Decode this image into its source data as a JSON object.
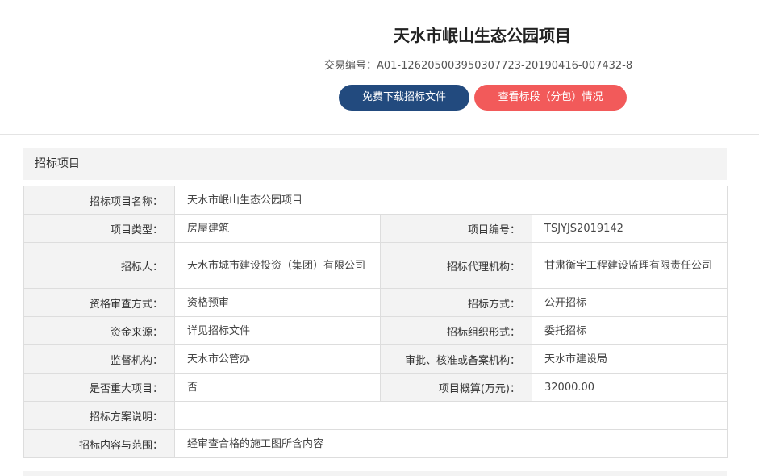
{
  "header": {
    "title": "天水市岷山生态公园项目",
    "transaction_code": "交易编号：A01-126205003950307723-20190416-007432-8",
    "download_button": "免费下载招标文件",
    "sections_button": "查看标段（分包）情况"
  },
  "section": {
    "title": "招标项目"
  },
  "rows": {
    "project_name": {
      "label": "招标项目名称：",
      "value": "天水市岷山生态公园项目"
    },
    "project_type": {
      "label": "项目类型：",
      "value": "房屋建筑"
    },
    "project_no": {
      "label": "项目编号：",
      "value": "TSJYJS2019142"
    },
    "tenderer": {
      "label": "招标人：",
      "value": "天水市城市建设投资（集团）有限公司"
    },
    "agency": {
      "label": "招标代理机构：",
      "value": "甘肃衡宇工程建设监理有限责任公司"
    },
    "qualification": {
      "label": "资格审查方式：",
      "value": "资格预审"
    },
    "tender_method": {
      "label": "招标方式：",
      "value": "公开招标"
    },
    "funding": {
      "label": "资金来源：",
      "value": "详见招标文件"
    },
    "organization_form": {
      "label": "招标组织形式：",
      "value": "委托招标"
    },
    "supervisor": {
      "label": "监督机构：",
      "value": "天水市公管办"
    },
    "approval": {
      "label": "审批、核准或备案机构：",
      "value": "天水市建设局"
    },
    "major_project": {
      "label": "是否重大项目：",
      "value": "否"
    },
    "budget": {
      "label": "项目概算(万元)：",
      "value": "32000.00"
    },
    "plan_description": {
      "label": "招标方案说明：",
      "value": ""
    },
    "scope": {
      "label": "招标内容与范围：",
      "value": "经审查合格的施工图所含内容"
    }
  }
}
